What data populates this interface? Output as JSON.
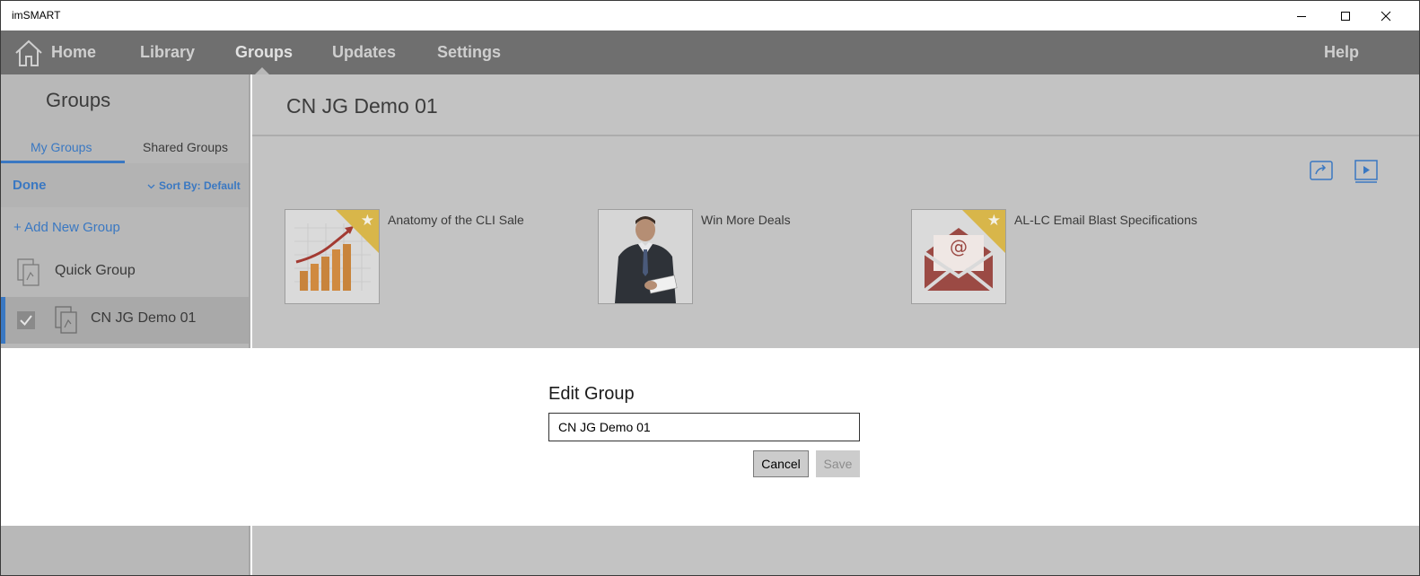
{
  "window": {
    "title": "imSMART",
    "controls": {
      "minimize_icon": "minimize-icon",
      "maximize_icon": "maximize-icon",
      "close_icon": "close-icon"
    }
  },
  "nav": {
    "home_icon": "home-icon",
    "items": [
      "Home",
      "Library",
      "Groups",
      "Updates",
      "Settings"
    ],
    "active": "Groups",
    "help": "Help"
  },
  "sidebar": {
    "title": "Groups",
    "tabs": [
      "My Groups",
      "Shared Groups"
    ],
    "active_tab": "My Groups",
    "done": "Done",
    "sort_label": "Sort By:",
    "sort_value": "Default",
    "add_new": "+ Add New Group",
    "groups": [
      {
        "label": "Quick Group",
        "selected": false
      },
      {
        "label": "CN JG Demo 01",
        "selected": true
      }
    ]
  },
  "content": {
    "title": "CN JG Demo 01",
    "toolbar_icons": [
      "present-icon",
      "play-icon"
    ],
    "items": [
      {
        "name": "Anatomy of the CLI Sale",
        "favorite": true,
        "thumb_icon": "growth-chart-thumbnail"
      },
      {
        "name": "Win More Deals",
        "favorite": false,
        "thumb_icon": "businessman-thumbnail"
      },
      {
        "name": "AL-LC Email Blast Specifications",
        "favorite": true,
        "thumb_icon": "email-envelope-thumbnail"
      }
    ]
  },
  "modal": {
    "title": "Edit Group",
    "input_value": "CN JG Demo 01",
    "cancel": "Cancel",
    "save": "Save"
  },
  "colors": {
    "accent": "#3a78c2",
    "nav_bg": "#6f6f6f",
    "sidebar_bg": "#b8b8b8",
    "content_bg": "#c3c3c3",
    "favorite_corner": "#d8b64a",
    "email_red": "#9b4a44"
  }
}
